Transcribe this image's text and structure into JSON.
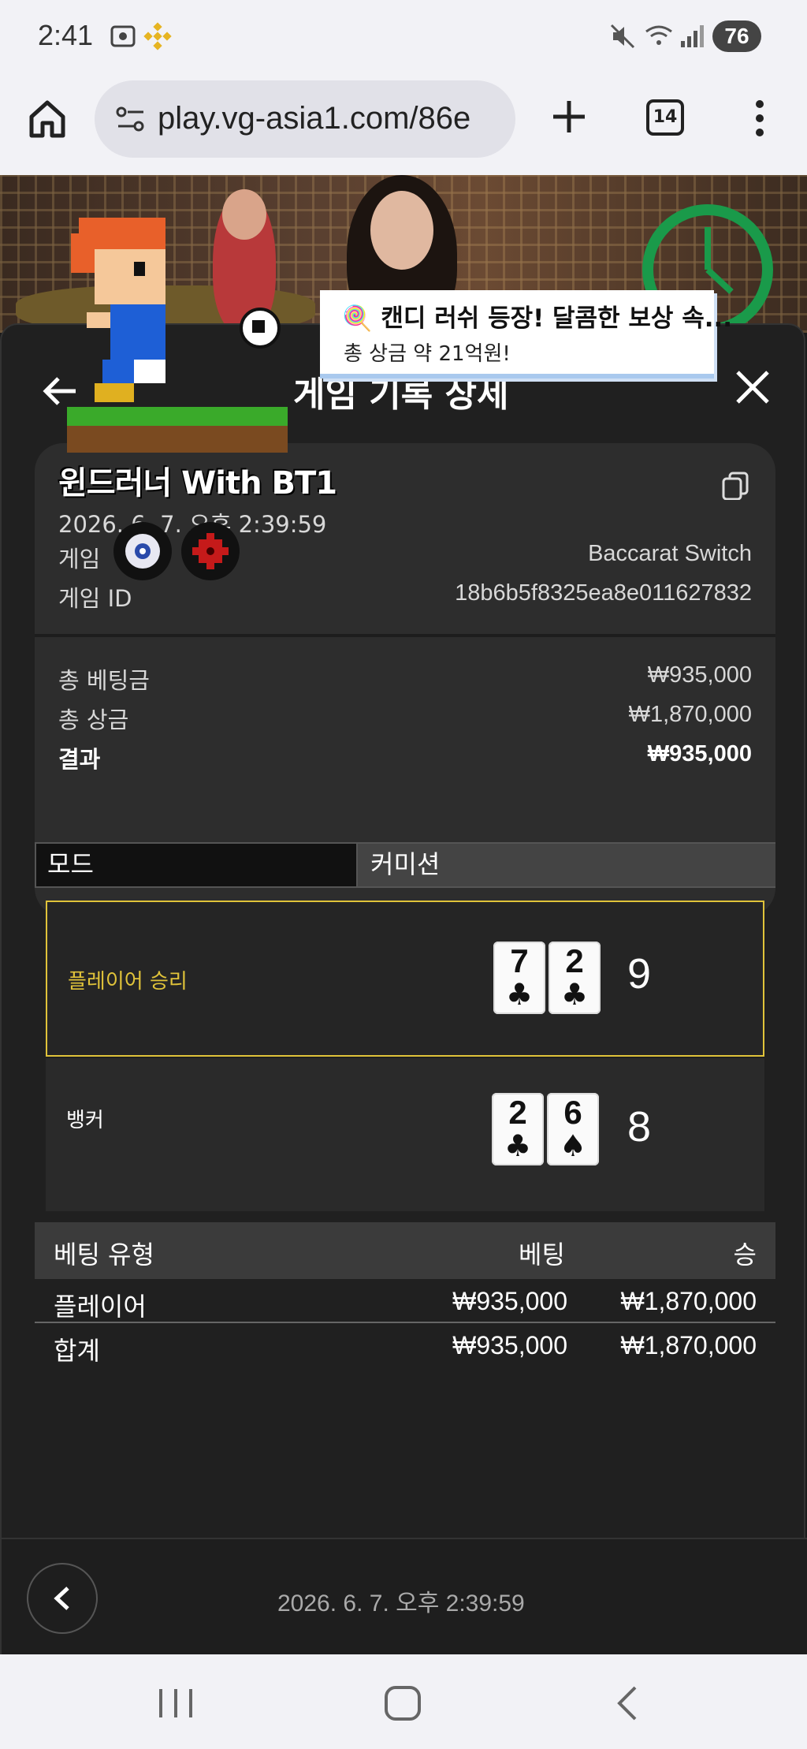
{
  "status_bar": {
    "time": "2:41",
    "battery": "76"
  },
  "browser": {
    "url": "play.vg-asia1.com/86e",
    "tab_count": "14"
  },
  "modal": {
    "title": "게임 기록 상세",
    "username": "윈드러너 With BT1",
    "datetime": "2026. 6. 7. 오후 2:39:59",
    "game_label": "게임",
    "game_value": "Baccarat Switch",
    "game_id_label": "게임 ID",
    "game_id_value": "18b6b5f8325ea8e011627832",
    "total_bet_label": "총 베팅금",
    "total_bet_value": "₩935,000",
    "total_win_label": "총 상금",
    "total_win_value": "₩1,870,000",
    "result_label": "결과",
    "result_value": "₩935,000"
  },
  "mode_bar": {
    "left": "모드",
    "right": "커미션"
  },
  "results": {
    "player": {
      "label": "플레이어 승리",
      "cards": [
        {
          "rank": "7",
          "suit": "♣"
        },
        {
          "rank": "2",
          "suit": "♣"
        }
      ],
      "score": "9"
    },
    "banker": {
      "label": "뱅커",
      "cards": [
        {
          "rank": "2",
          "suit": "♣"
        },
        {
          "rank": "6",
          "suit": "♠"
        }
      ],
      "score": "8"
    }
  },
  "bet_table": {
    "headers": [
      "베팅 유형",
      "베팅",
      "승"
    ],
    "rows": [
      {
        "type": "플레이어",
        "bet": "₩935,000",
        "win": "₩1,870,000"
      }
    ],
    "total": {
      "type": "합계",
      "bet": "₩935,000",
      "win": "₩1,870,000"
    }
  },
  "footer": {
    "datetime": "2026. 6. 7. 오후 2:39:59"
  },
  "promo": {
    "emoji": "🍭",
    "title": "캔디 러쉬 등장! 달콤한 보상 속...",
    "subtitle": "총 상금 약 21억원!"
  },
  "colors": {
    "accent_gold": "#e0c33a",
    "modal_bg": "#202020",
    "card_bg": "#2d2d2d"
  }
}
